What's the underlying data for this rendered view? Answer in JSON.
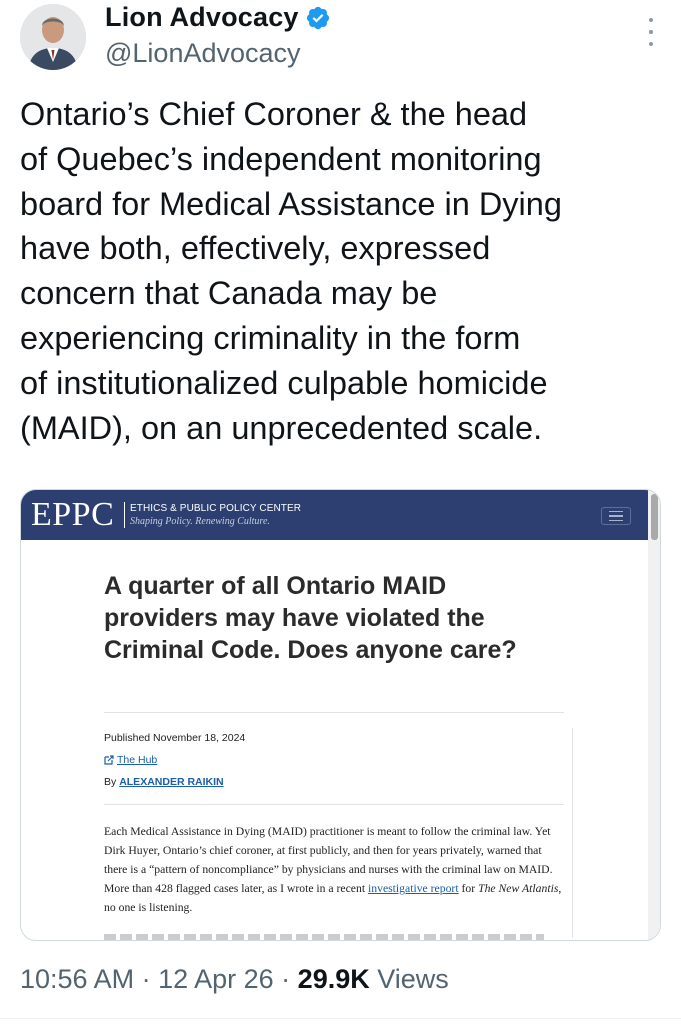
{
  "author": {
    "display_name": "Lion Advocacy",
    "handle": "@LionAdvocacy",
    "verified": true,
    "icons": {
      "avatar": "profile-photo",
      "verified": "verified-badge-icon",
      "more": "more-options-icon"
    }
  },
  "tweet": {
    "text": "Ontario’s Chief Coroner & the head\nof Quebec’s independent monitoring\nboard for Medical Assistance in Dying\nhave both, effectively, expressed\nconcern that Canada may be\nexperiencing criminality in the form\nof institutionalized culpable homicide\n(MAID), on an unprecedented scale."
  },
  "card": {
    "site": {
      "logo": "EPPC",
      "name": "ETHICS & PUBLIC POLICY CENTER",
      "tagline": "Shaping Policy. Renewing Culture.",
      "menu_icon": "hamburger-menu-icon"
    },
    "article": {
      "title": "A quarter of all Ontario MAID providers may have violated the Criminal Code. Does anyone care?",
      "published": "Published November 18, 2024",
      "source": "The Hub",
      "byline_prefix": "By",
      "author": "ALEXANDER RAIKIN",
      "body_part1": "Each Medical Assistance in Dying (MAID) practitioner is meant to follow the criminal law. Yet Dirk Huyer, Ontario’s chief coroner, at first publicly, and then for years privately, warned that there is a “pattern of noncompliance” by physicians and nurses with the criminal law on MAID. More than 428 flagged cases later, as I wrote in a recent ",
      "body_link": "investigative report",
      "body_part2": " for ",
      "body_publication": "The New Atlantis",
      "body_part3": ", no one is listening."
    }
  },
  "meta": {
    "time": "10:56 AM",
    "separator": " · ",
    "date": "12 Apr 26",
    "views_count": "29.9K",
    "views_label": " Views"
  },
  "colors": {
    "text": "#0f1419",
    "secondary": "#536471",
    "verified": "#1d9bf0",
    "eppc_bar": "#2c3f70",
    "link": "#1a5fa8"
  }
}
